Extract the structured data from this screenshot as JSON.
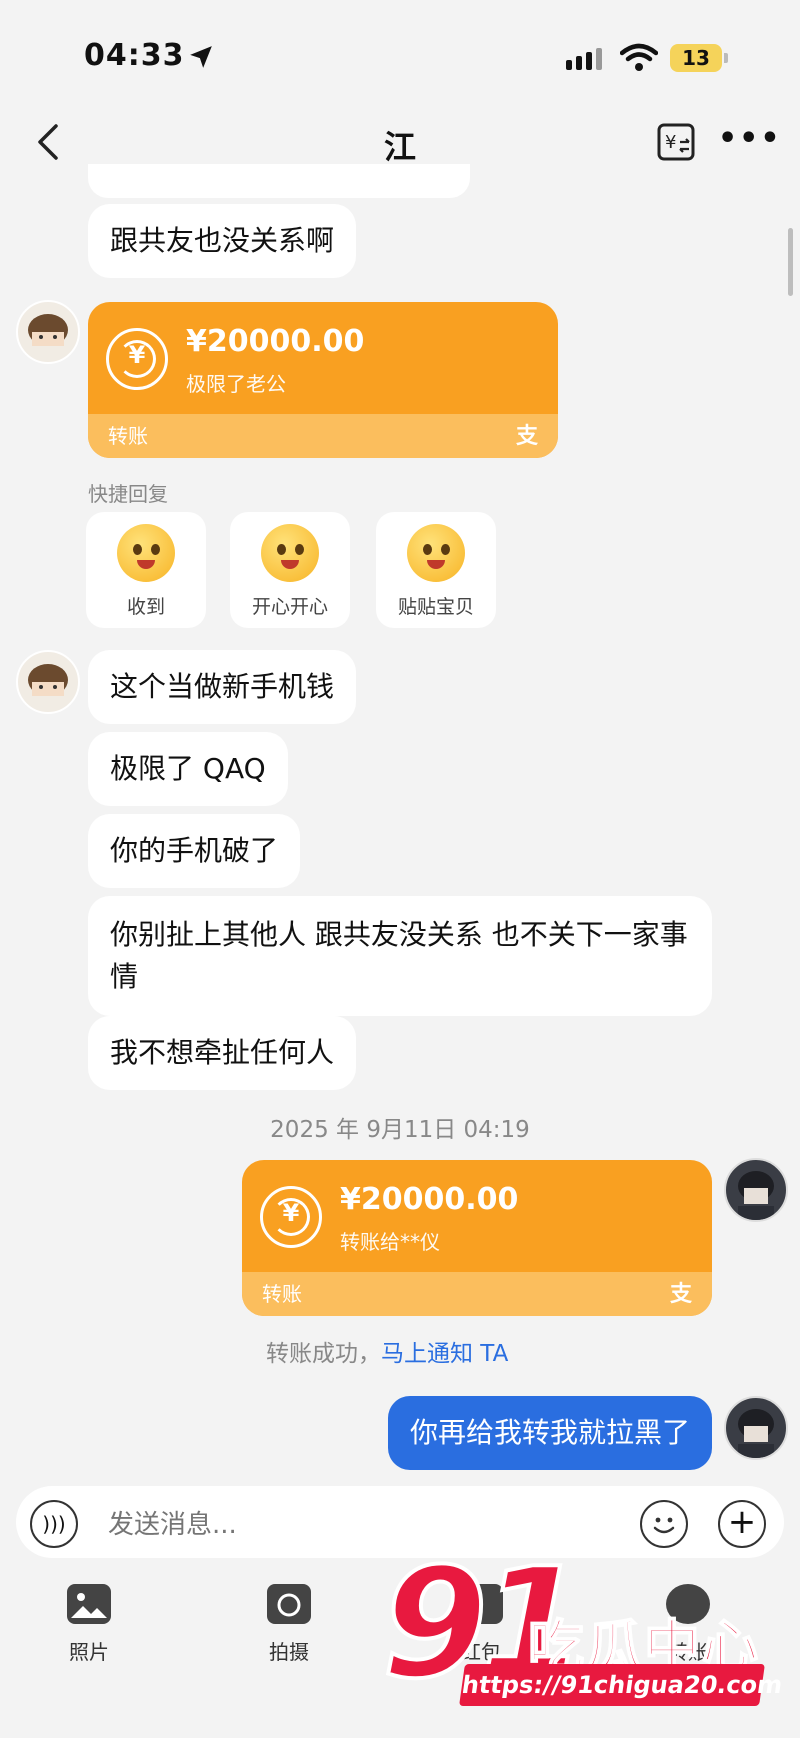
{
  "status_bar": {
    "time": "04:33",
    "battery": "13"
  },
  "header": {
    "title": "江"
  },
  "messages": {
    "m1": "跟共友也没关系啊",
    "m2": "这个当做新手机钱",
    "m3": "极限了 QAQ",
    "m4": "你的手机破了",
    "m5": "你别扯上其他人 跟共友没关系 也不关下一家事情",
    "m6": "我不想牵扯任何人",
    "m7": "你再给我转我就拉黑了"
  },
  "transfer_received": {
    "amount": "¥20000.00",
    "note": "极限了老公",
    "footer": "转账",
    "brand_glyph": "支"
  },
  "quick_reply": {
    "label": "快捷回复",
    "items": [
      "收到",
      "开心开心",
      "贴贴宝贝"
    ]
  },
  "timestamp": "2025 年 9月11日 04:19",
  "transfer_sent": {
    "amount": "¥20000.00",
    "note": "转账给**仪",
    "footer": "转账",
    "brand_glyph": "支"
  },
  "transfer_status": {
    "text": "转账成功，",
    "link": "马上通知 TA"
  },
  "input": {
    "placeholder": "发送消息..."
  },
  "toolbar": {
    "photo": "照片",
    "camera": "拍摄",
    "redpacket": "红包",
    "transfer": "转账"
  },
  "watermark": {
    "number": "91",
    "text": "吃瓜中心",
    "url": "https://91chigua20.com"
  },
  "colors": {
    "accent_blue": "#2a6ee0",
    "transfer_orange": "#f9a021",
    "watermark_red": "#e8193f"
  }
}
